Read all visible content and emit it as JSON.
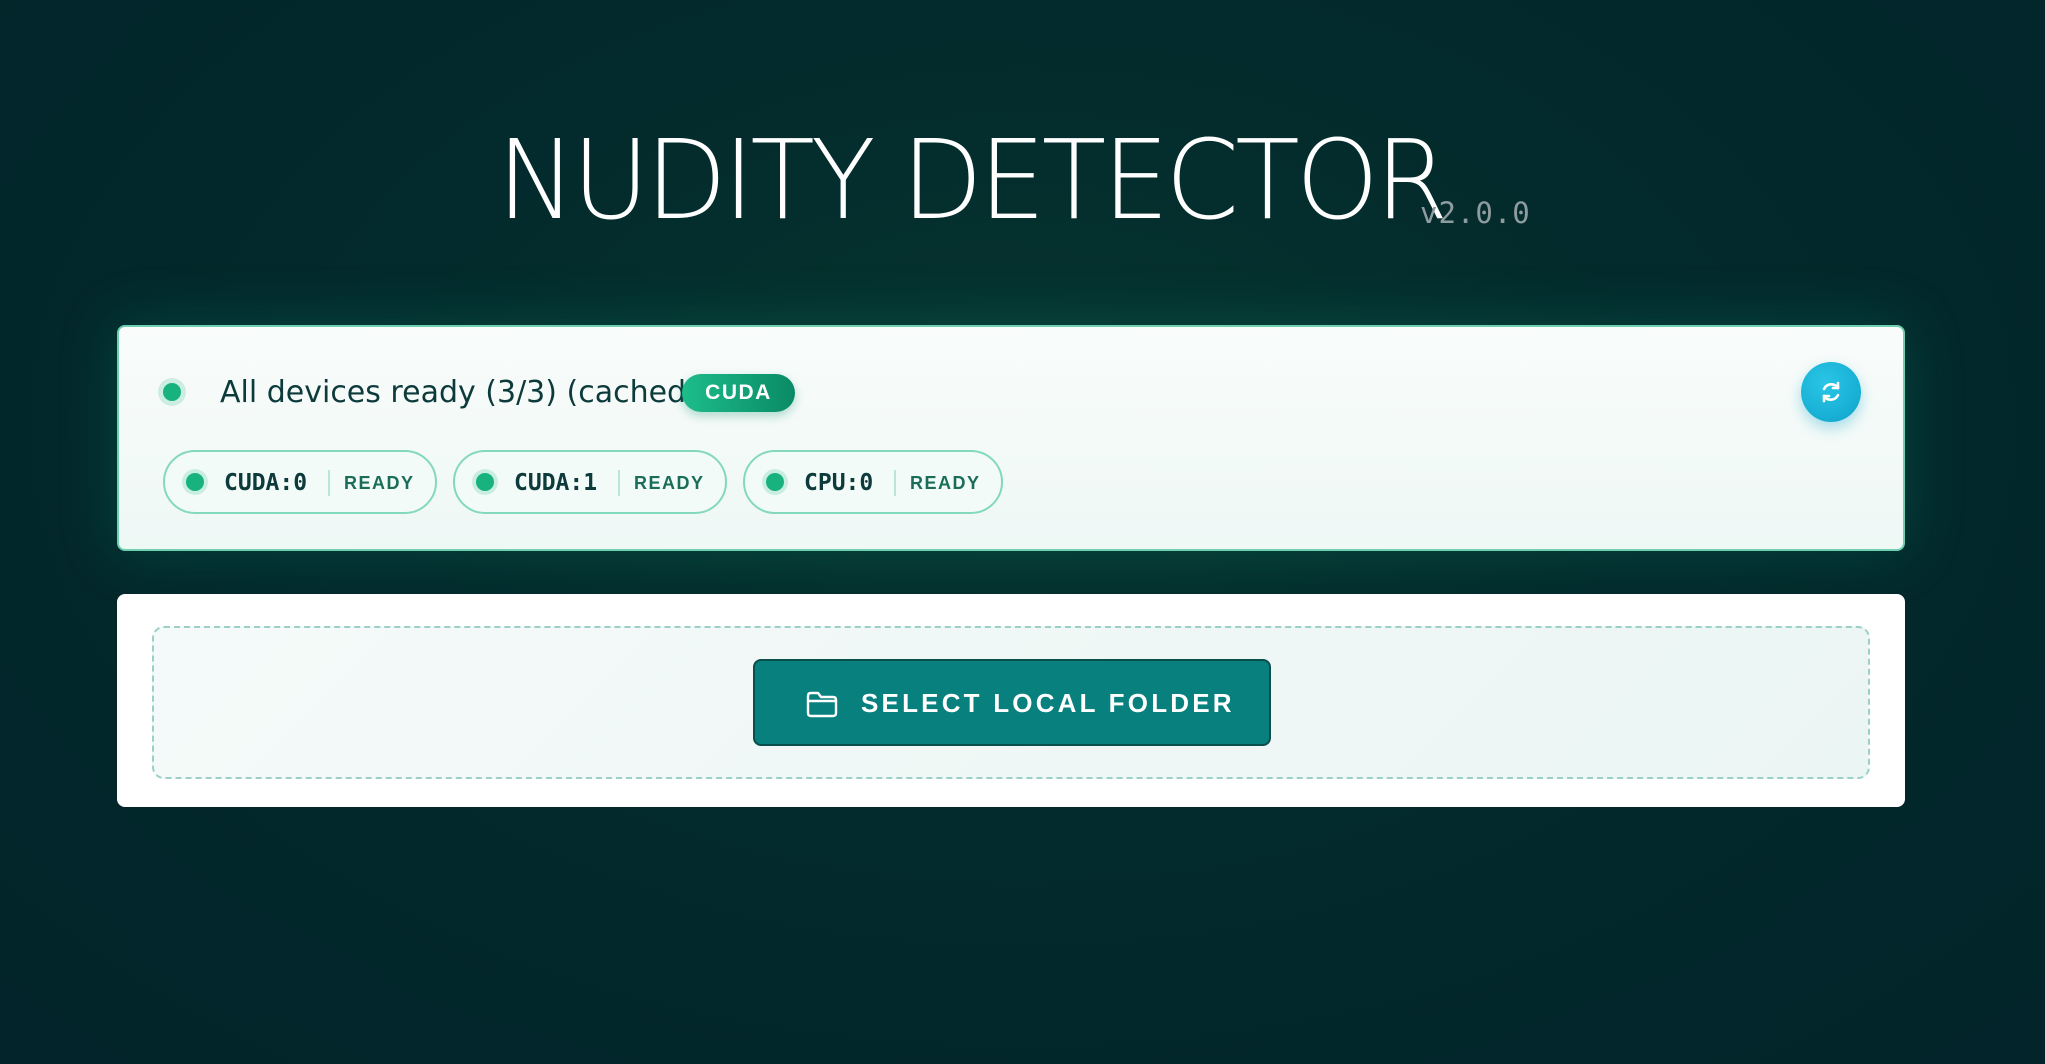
{
  "header": {
    "title": "NUDITY DETECTOR",
    "version": "v2.0.0"
  },
  "status": {
    "message": "All devices ready (3/3) (cached)",
    "backend_badge": "CUDA",
    "refresh_icon": "refresh-icon",
    "devices": [
      {
        "name": "CUDA:0",
        "state": "READY"
      },
      {
        "name": "CUDA:1",
        "state": "READY"
      },
      {
        "name": "CPU:0",
        "state": "READY"
      }
    ]
  },
  "folder": {
    "button_label": "SELECT LOCAL FOLDER",
    "icon": "folder-icon"
  },
  "colors": {
    "background": "#032a2c",
    "ready_green": "#17b27e",
    "accent_teal": "#07807e",
    "refresh_blue": "#0fa3cb"
  }
}
